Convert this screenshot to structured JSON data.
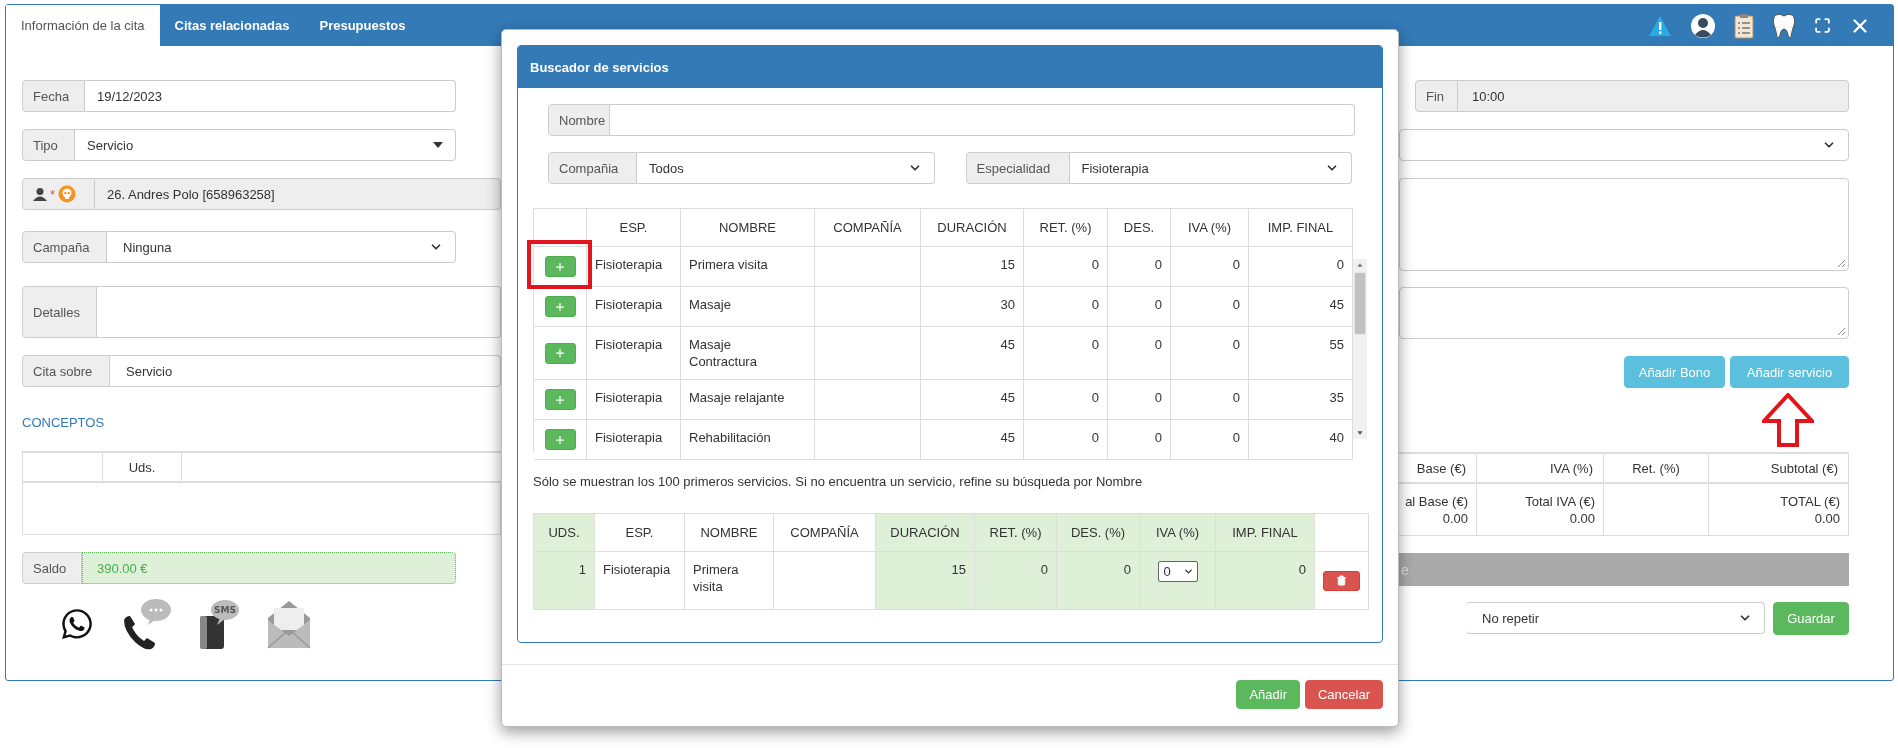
{
  "tabs": [
    {
      "label": "Información de la cita",
      "selected": true
    },
    {
      "label": "Citas relacionadas",
      "selected": false
    },
    {
      "label": "Presupuestos",
      "selected": false
    }
  ],
  "form": {
    "fecha": {
      "label": "Fecha",
      "value": "19/12/2023"
    },
    "tipo": {
      "label": "Tipo",
      "value": "Servicio"
    },
    "patient": {
      "required_mark": "*",
      "value": "26. Andres Polo [658963258]"
    },
    "campana": {
      "label": "Campaña",
      "value": "Ninguna"
    },
    "detalles": {
      "label": "Detalles"
    },
    "cita_sobre": {
      "label": "Cita sobre",
      "value": "Servicio"
    },
    "fin": {
      "label": "Fin",
      "value": "10:00"
    }
  },
  "actions": {
    "add_bono": "Añadir Bono",
    "add_service": {
      "label": "Añadir servicio",
      "pointer_arrow": true
    }
  },
  "conceptos": {
    "title": "CONCEPTOS",
    "left_columns": [
      "Uds."
    ],
    "right_columns": [
      "Base (€)",
      "IVA (%)",
      "Ret. (%)",
      "Subtotal (€)"
    ],
    "totals": [
      {
        "kind": "total",
        "label": "al Base (€)",
        "value": "0.00"
      },
      {
        "kind": "total",
        "label": "Total IVA (€)",
        "value": "0.00"
      },
      {
        "kind": "empty"
      },
      {
        "kind": "total",
        "label": "TOTAL (€)",
        "value": "0.00"
      }
    ]
  },
  "saldo": {
    "label": "Saldo",
    "value": "390.00 €"
  },
  "grey_bar": {
    "text": "e"
  },
  "channels": [
    {
      "kind": "whatsapp"
    },
    {
      "kind": "phone"
    },
    {
      "kind": "sms",
      "label": "SMS"
    },
    {
      "kind": "email"
    }
  ],
  "repeat": {
    "value": "No repetir"
  },
  "save_button": "Guardar",
  "modal": {
    "title": "Buscador de servicios",
    "nombre": {
      "label": "Nombre"
    },
    "compania": {
      "label": "Compañia",
      "value": "Todos"
    },
    "especialidad": {
      "label": "Especialidad",
      "value": "Fisioterapia"
    },
    "results": {
      "columns": [
        "ESP.",
        "NOMBRE",
        "COMPAÑÍA",
        "DURACIÓN",
        "RET. (%)",
        "DES.",
        "IVA (%)",
        "IMP. FINAL"
      ],
      "rows": [
        {
          "esp": "Fisioterapia",
          "nombre": "Primera visita",
          "duracion": "15",
          "ret": "0",
          "des": "0",
          "iva": "0",
          "imp": "0",
          "highlighted": true
        },
        {
          "esp": "Fisioterapia",
          "nombre": "Masaje",
          "duracion": "30",
          "ret": "0",
          "des": "0",
          "iva": "0",
          "imp": "45",
          "highlighted": false
        },
        {
          "esp": "Fisioterapia",
          "nombre": "Masaje Contractura",
          "duracion": "45",
          "ret": "0",
          "des": "0",
          "iva": "0",
          "imp": "55",
          "highlighted": false
        },
        {
          "esp": "Fisioterapia",
          "nombre": "Masaje relajante",
          "duracion": "45",
          "ret": "0",
          "des": "0",
          "iva": "0",
          "imp": "35",
          "highlighted": false
        },
        {
          "esp": "Fisioterapia",
          "nombre": "Rehabilitación",
          "duracion": "45",
          "ret": "0",
          "des": "0",
          "iva": "0",
          "imp": "40",
          "highlighted": false
        }
      ]
    },
    "note": "Sólo se muestran los 100 primeros servicios. Si no encuentra un servicio, refine su búsqueda por Nombre",
    "selected": {
      "columns": [
        {
          "label": "UDS.",
          "shaded": true
        },
        {
          "label": "ESP.",
          "shaded": false
        },
        {
          "label": "NOMBRE",
          "shaded": false
        },
        {
          "label": "COMPAÑÍA",
          "shaded": false
        },
        {
          "label": "DURACIÓN",
          "shaded": true
        },
        {
          "label": "RET. (%)",
          "shaded": true
        },
        {
          "label": "DES. (%)",
          "shaded": true
        },
        {
          "label": "IVA (%)",
          "shaded": true
        },
        {
          "label": "IMP. FINAL",
          "shaded": true
        }
      ],
      "rows": [
        {
          "uds": "1",
          "esp": "Fisioterapia",
          "nombre": "Primera visita",
          "duracion": "15",
          "ret": "0",
          "des": "0",
          "iva": "0",
          "imp": "0"
        }
      ]
    },
    "buttons": {
      "add": "Añadir",
      "cancel": "Cancelar"
    }
  }
}
